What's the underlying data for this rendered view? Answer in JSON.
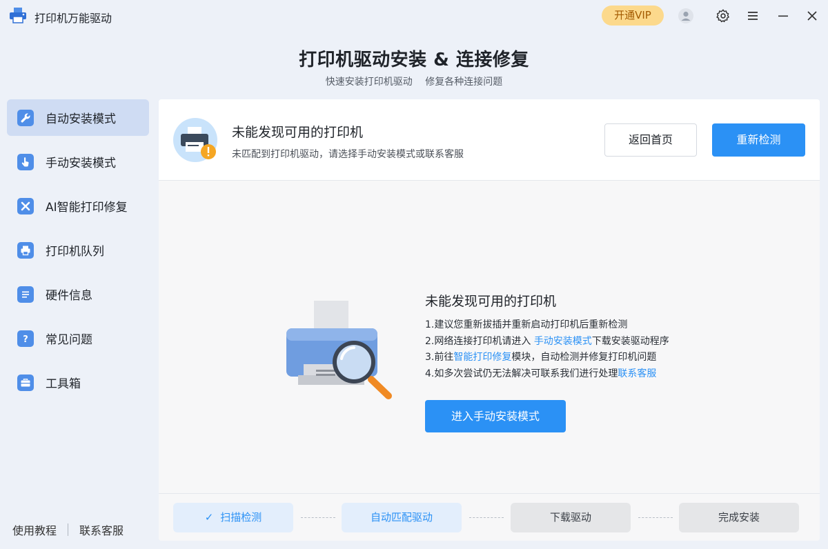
{
  "app": {
    "title": "打印机万能驱动",
    "vip_label": "开通VIP",
    "colors": {
      "accent": "#2b91f5",
      "vip_bg": "#fcd98c",
      "vip_text": "#a35a00",
      "warning": "#f5a623"
    }
  },
  "header": {
    "title": "打印机驱动安装 & 连接修复",
    "subtitle_left": "快速安装打印机驱动",
    "subtitle_right": "修复各种连接问题"
  },
  "sidebar": {
    "items": [
      {
        "label": "自动安装模式",
        "icon": "wrench-icon",
        "active": true
      },
      {
        "label": "手动安装模式",
        "icon": "hand-pointer-icon",
        "active": false
      },
      {
        "label": "AI智能打印修复",
        "icon": "tools-icon",
        "active": false
      },
      {
        "label": "打印机队列",
        "icon": "printer-icon",
        "active": false
      },
      {
        "label": "硬件信息",
        "icon": "list-icon",
        "active": false
      },
      {
        "label": "常见问题",
        "icon": "question-icon",
        "active": false
      },
      {
        "label": "工具箱",
        "icon": "toolbox-icon",
        "active": false
      }
    ],
    "footer": {
      "tutorial": "使用教程",
      "support": "联系客服"
    }
  },
  "status": {
    "title": "未能发现可用的打印机",
    "description": "未匹配到打印机驱动，请选择手动安装模式或联系客服",
    "home_button": "返回首页",
    "rescan_button": "重新检测"
  },
  "empty": {
    "title": "未能发现可用的打印机",
    "tip1": "1.建议您重新拔插并重新启动打印机后重新检测",
    "tip2_prefix": "2.网络连接打印机请进入 ",
    "tip2_link": "手动安装模式",
    "tip2_suffix": "下载安装驱动程序",
    "tip3_prefix": "3.前往",
    "tip3_link": "智能打印修复",
    "tip3_suffix": "模块，自动检测并修复打印机问题",
    "tip4_prefix": "4.如多次尝试仍无法解决可联系我们进行处理",
    "tip4_link": "联系客服",
    "manual_button": "进入手动安装模式"
  },
  "steps": [
    {
      "label": "扫描检测",
      "state": "done"
    },
    {
      "label": "自动匹配驱动",
      "state": "current"
    },
    {
      "label": "下载驱动",
      "state": "pending"
    },
    {
      "label": "完成安装",
      "state": "pending"
    }
  ]
}
